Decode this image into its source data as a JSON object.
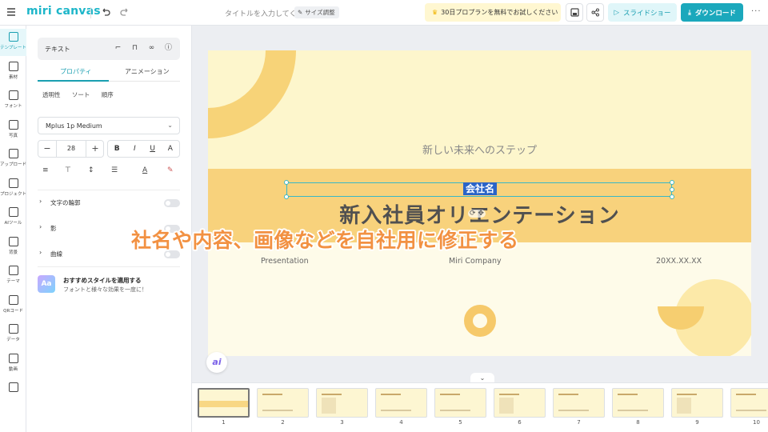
{
  "topbar": {
    "logo": "miri canvas",
    "doc_title_placeholder": "タイトルを入力してく...",
    "resize_label": "サイズ調整",
    "promo_label": "30日プロプランを無料でお試しください",
    "slideshow_label": "スライドショー",
    "download_label": "ダウンロード",
    "more_label": "···"
  },
  "rail": {
    "items": [
      {
        "label": "テンプレート",
        "icon": "template-icon"
      },
      {
        "label": "素材",
        "icon": "elements-icon"
      },
      {
        "label": "フォント",
        "icon": "text-icon"
      },
      {
        "label": "写真",
        "icon": "photo-icon"
      },
      {
        "label": "アップロード",
        "icon": "upload-icon"
      },
      {
        "label": "プロジェクト",
        "icon": "project-icon"
      },
      {
        "label": "AIツール",
        "icon": "ai-tools-icon"
      },
      {
        "label": "背景",
        "icon": "background-icon"
      },
      {
        "label": "テーマ",
        "icon": "theme-icon"
      },
      {
        "label": "QRコード",
        "icon": "qr-code-icon"
      },
      {
        "label": "データ",
        "icon": "data-icon"
      },
      {
        "label": "動画",
        "icon": "video-icon"
      },
      {
        "label": "",
        "icon": "music-icon"
      }
    ]
  },
  "panel": {
    "header_label": "テキスト",
    "tabs": [
      "プロパティ",
      "アニメーション"
    ],
    "subtabs": [
      "透明性",
      "ソート",
      "順序"
    ],
    "font_name": "Mplus 1p Medium",
    "font_size": "28",
    "style_buttons": [
      "B",
      "I",
      "U",
      "A"
    ],
    "toggles": [
      "文字の輪郭",
      "影",
      "曲線"
    ],
    "recommend_title": "おすすめスタイルを適用する",
    "recommend_desc": "フォントと様々な効果を一度に！",
    "recommend_badge": "Aa"
  },
  "slide": {
    "subtitle": "新しい未来へのステップ",
    "company": "会社名",
    "title": "新入社員オリエンテーション",
    "footer_left": "Presentation",
    "footer_center": "Miri Company",
    "footer_right": "20XX.XX.XX"
  },
  "overlay_caption": "社名や内容、画像などを自社用に修正する",
  "ai_button_label": "ai",
  "thumbnails": {
    "numbers": [
      "1",
      "2",
      "3",
      "4",
      "5",
      "6",
      "7",
      "8",
      "9",
      "10"
    ],
    "active_index": 0
  },
  "colors": {
    "accent": "#1ba8bc",
    "slide_bg": "#fdf6cc",
    "band": "#f8d27c",
    "caption": "#f29142",
    "selection": "#2a64c8"
  }
}
